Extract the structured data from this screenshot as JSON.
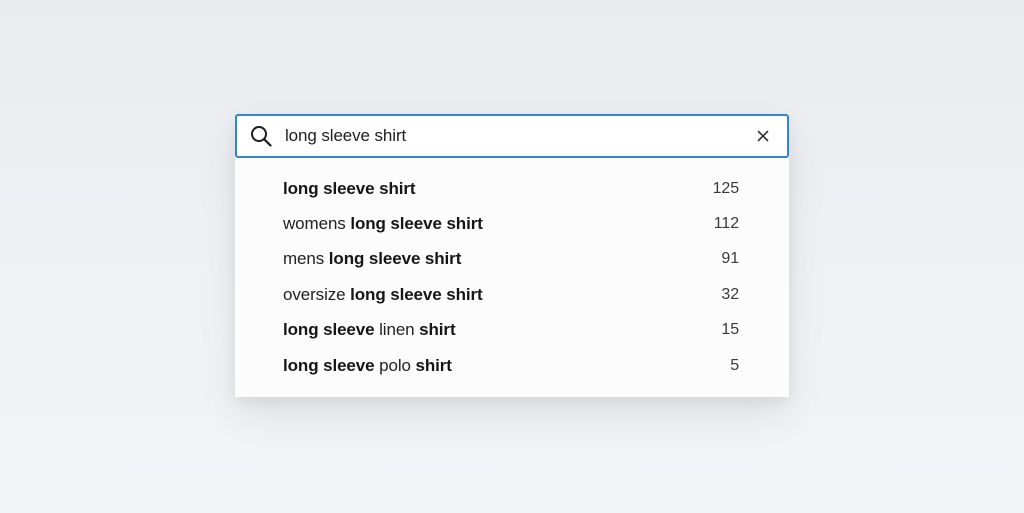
{
  "search": {
    "value": "long sleeve shirt",
    "icon": "search-icon",
    "clear_icon": "close-icon",
    "accent_color": "#2f86d6"
  },
  "suggestions": [
    {
      "parts": [
        {
          "text": "long sleeve shirt",
          "bold": true
        }
      ],
      "count": "125"
    },
    {
      "parts": [
        {
          "text": "womens ",
          "bold": false
        },
        {
          "text": "long sleeve shirt",
          "bold": true
        }
      ],
      "count": "112"
    },
    {
      "parts": [
        {
          "text": "mens ",
          "bold": false
        },
        {
          "text": "long sleeve shirt",
          "bold": true
        }
      ],
      "count": "91"
    },
    {
      "parts": [
        {
          "text": "oversize ",
          "bold": false
        },
        {
          "text": "long sleeve shirt",
          "bold": true
        }
      ],
      "count": "32"
    },
    {
      "parts": [
        {
          "text": "long sleeve",
          "bold": true
        },
        {
          "text": " linen ",
          "bold": false
        },
        {
          "text": "shirt",
          "bold": true
        }
      ],
      "count": "15"
    },
    {
      "parts": [
        {
          "text": "long sleeve",
          "bold": true
        },
        {
          "text": " polo ",
          "bold": false
        },
        {
          "text": "shirt",
          "bold": true
        }
      ],
      "count": "5"
    }
  ]
}
